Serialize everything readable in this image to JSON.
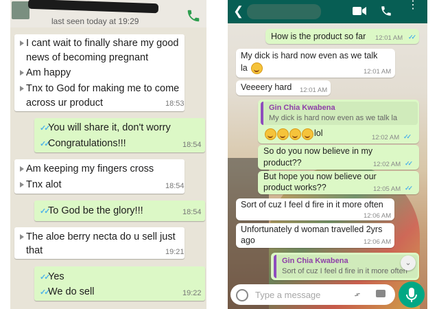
{
  "left": {
    "header": {
      "status": "last seen today at 19:29"
    },
    "messages": [
      {
        "dir": "in",
        "lines": [
          "I cant wait to finally share my good",
          "news of becoming pregnant",
          "Am happy",
          "Tnx to God for making me to come",
          "across ur product"
        ],
        "time": "18:53"
      },
      {
        "dir": "out",
        "lines": [
          "You will share it, don't worry",
          "Congratulations!!!"
        ],
        "time": "18:54"
      },
      {
        "dir": "in",
        "lines": [
          "Am keeping my fingers cross",
          "Tnx alot"
        ],
        "time": "18:54"
      },
      {
        "dir": "out",
        "lines": [
          "To God be the glory!!!"
        ],
        "time": "18:54"
      },
      {
        "dir": "in",
        "lines": [
          "The aloe berry necta do u sell just",
          "that"
        ],
        "time": "19:21"
      },
      {
        "dir": "out",
        "lines": [
          "Yes",
          "We do sell"
        ],
        "time": "19:22"
      }
    ]
  },
  "right": {
    "messages": [
      {
        "dir": "out",
        "text": "How is the product so far",
        "time": "12:01 AM"
      },
      {
        "dir": "in",
        "text1": "My dick is hard now even as we talk",
        "text2": "la",
        "time": "12:01 AM"
      },
      {
        "dir": "in",
        "text": "Veeeery hard",
        "time": "12:01 AM"
      },
      {
        "dir": "out",
        "quote_name": "Gin Chia Kwabena",
        "quote_text": "My dick is hard now even as we talk la",
        "text": "lol",
        "time": "12:02 AM"
      },
      {
        "dir": "out",
        "text1": "So do you now believe in my",
        "text2": "product??",
        "time": "12:02 AM"
      },
      {
        "dir": "out",
        "text1": "But hope you now believe our",
        "text2": "product works??",
        "time": "12:05 AM"
      },
      {
        "dir": "in",
        "text": "Sort of cuz I feel d fire in it more often",
        "time": "12:06 AM"
      },
      {
        "dir": "in",
        "text1": "Unfortunately d woman travelled 2yrs",
        "text2": "ago",
        "time": "12:06 AM"
      },
      {
        "dir": "out",
        "quote_name": "Gin Chia Kwabena",
        "quote_text": "Sort of cuz I feel d fire in it more often"
      }
    ],
    "input": {
      "placeholder": "Type a message"
    },
    "colors": {
      "header": "#075e54",
      "outgoing": "#dcf8c6",
      "incoming": "#ffffff",
      "quote_name": "#8e3fa8",
      "ticks": "#4fb3e8",
      "send_button": "#00a884"
    }
  }
}
